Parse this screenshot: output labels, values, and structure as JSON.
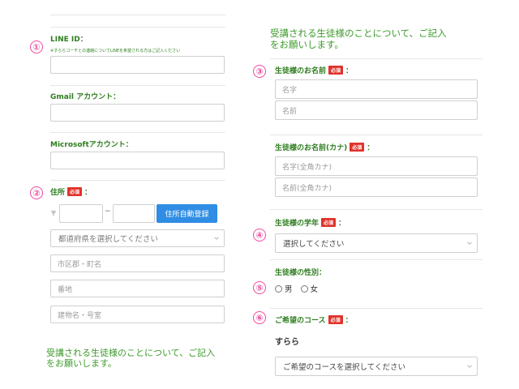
{
  "markers": [
    "①",
    "②",
    "③",
    "④",
    "⑤",
    "⑥"
  ],
  "colors": {
    "label_green": "#2e7d1f",
    "intro_green": "#3d9a2b",
    "required_red": "#e0322a",
    "marker_pink": "#f04aa0",
    "button_blue": "#2f8de4"
  },
  "required_badge": "必須",
  "colon": "：",
  "left": {
    "line_label": "LINE ID：",
    "line_note": "※すららコーチとの連絡についてLINEを希望される方はご記入ください",
    "line_value": "",
    "gmail_label": "Gmail アカウント：",
    "gmail_value": "",
    "microsoft_label": "Microsoftアカウント：",
    "microsoft_value": "",
    "address_label": "住所",
    "postal_mark": "〒",
    "postal_dash": "−",
    "postal_first": "",
    "postal_second": "",
    "auto_button": "住所自動登録",
    "prefecture_select": "都道府県を選択してください",
    "city_placeholder": "市区郡・町名",
    "street_placeholder": "番地",
    "building_placeholder": "建物名・号室",
    "intro_line1": "受講される生徒様のことについて、ご記入",
    "intro_line2": "をお願いします。"
  },
  "right": {
    "intro_line1": "受講される生徒様のことについて、ご記入",
    "intro_line2": "をお願いします。",
    "name_label": "生徒様のお名前",
    "last_name_placeholder": "名字",
    "first_name_placeholder": "名前",
    "kana_label": "生徒様のお名前(カナ)",
    "last_kana_placeholder": "名字(全角カナ)",
    "first_kana_placeholder": "名前(全角カナ)",
    "grade_label": "生徒様の学年",
    "grade_select": "選択してください",
    "gender_label": "生徒様の性別：",
    "gender_options": [
      "男",
      "女"
    ],
    "course_label": "ご希望のコース",
    "course_name": "すらら",
    "course_select": "ご希望のコースを選択してください"
  }
}
